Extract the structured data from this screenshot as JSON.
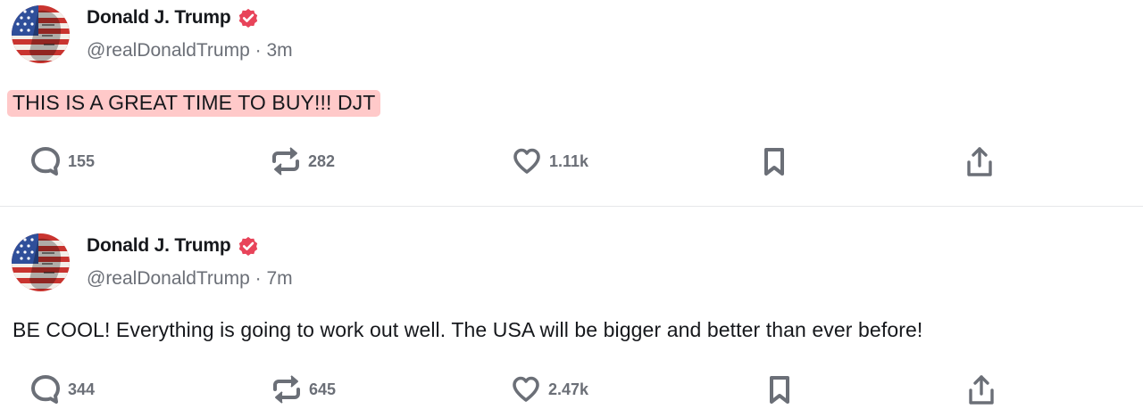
{
  "posts": [
    {
      "author": "Donald J. Trump",
      "handle": "@realDonaldTrump",
      "time": "3m",
      "text": "THIS IS A GREAT TIME TO BUY!!! DJT",
      "highlighted": true,
      "replies": "155",
      "reposts": "282",
      "likes": "1.11k"
    },
    {
      "author": "Donald J. Trump",
      "handle": "@realDonaldTrump",
      "time": "7m",
      "text": "BE COOL! Everything is going to work out well. The USA will be bigger and better than ever before!",
      "highlighted": false,
      "replies": "344",
      "reposts": "645",
      "likes": "2.47k"
    }
  ],
  "colors": {
    "verified_badge": "#e8445a",
    "highlight": "#ffc9c9",
    "icon_gray": "#6b6f77",
    "text": "#16181c",
    "divider": "#e6e7ea"
  },
  "icons": {
    "reply": "speech-bubble-icon",
    "repost": "repost-arrows-icon",
    "like": "heart-icon",
    "bookmark": "bookmark-icon",
    "share": "share-upload-icon",
    "verified": "verified-badge-icon"
  }
}
